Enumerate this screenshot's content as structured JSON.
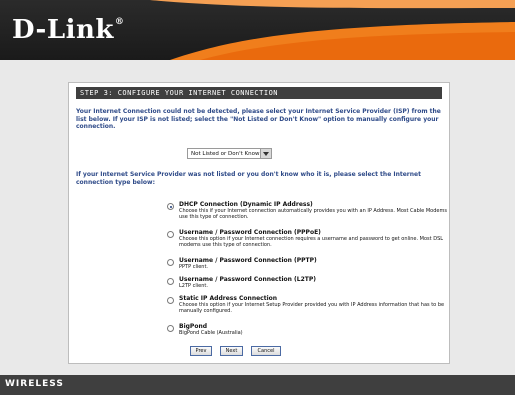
{
  "brand": {
    "logo": "D-Link",
    "reg_mark": "®"
  },
  "step_title": "STEP 3: CONFIGURE YOUR INTERNET CONNECTION",
  "intro_text": "Your Internet Connection could not be detected, please select your Internet Service Provider (ISP) from the list below. If your ISP is not listed; select the \"Not Listed or Don't Know\" option to manually configure your connection.",
  "isp_select": {
    "value": "Not Listed or Don't Know"
  },
  "question_text": "If your Internet Service Provider was not listed or you don't know who it is, please select the Internet connection type below:",
  "options": [
    {
      "title": "DHCP Connection (Dynamic IP Address)",
      "desc": "Choose this if your Internet connection automatically provides you with an IP Address. Most Cable Modems use this type of connection.",
      "selected": true
    },
    {
      "title": "Username / Password Connection (PPPoE)",
      "desc": "Choose this option if your Internet connection requires a username and password to get online. Most DSL modems use this type of connection.",
      "selected": false
    },
    {
      "title": "Username / Password Connection (PPTP)",
      "desc": "PPTP client.",
      "selected": false
    },
    {
      "title": "Username / Password Connection (L2TP)",
      "desc": "L2TP client.",
      "selected": false
    },
    {
      "title": "Static IP Address Connection",
      "desc": "Choose this option if your Internet Setup Provider provided you with IP Address information that has to be manually configured.",
      "selected": false
    },
    {
      "title": "BigPond",
      "desc": "BigPond Cable (Australia)",
      "selected": false
    }
  ],
  "buttons": {
    "prev": "Prev",
    "next": "Next",
    "cancel": "Cancel"
  },
  "footer": {
    "label": "WIRELESS"
  },
  "colors": {
    "header_bg": "#1a1a1a",
    "swoosh": "#f07e1c",
    "panel_title_bg": "#3f3f3f",
    "text_blue": "#2e4a88",
    "footer_bg": "#3f3f3f"
  }
}
